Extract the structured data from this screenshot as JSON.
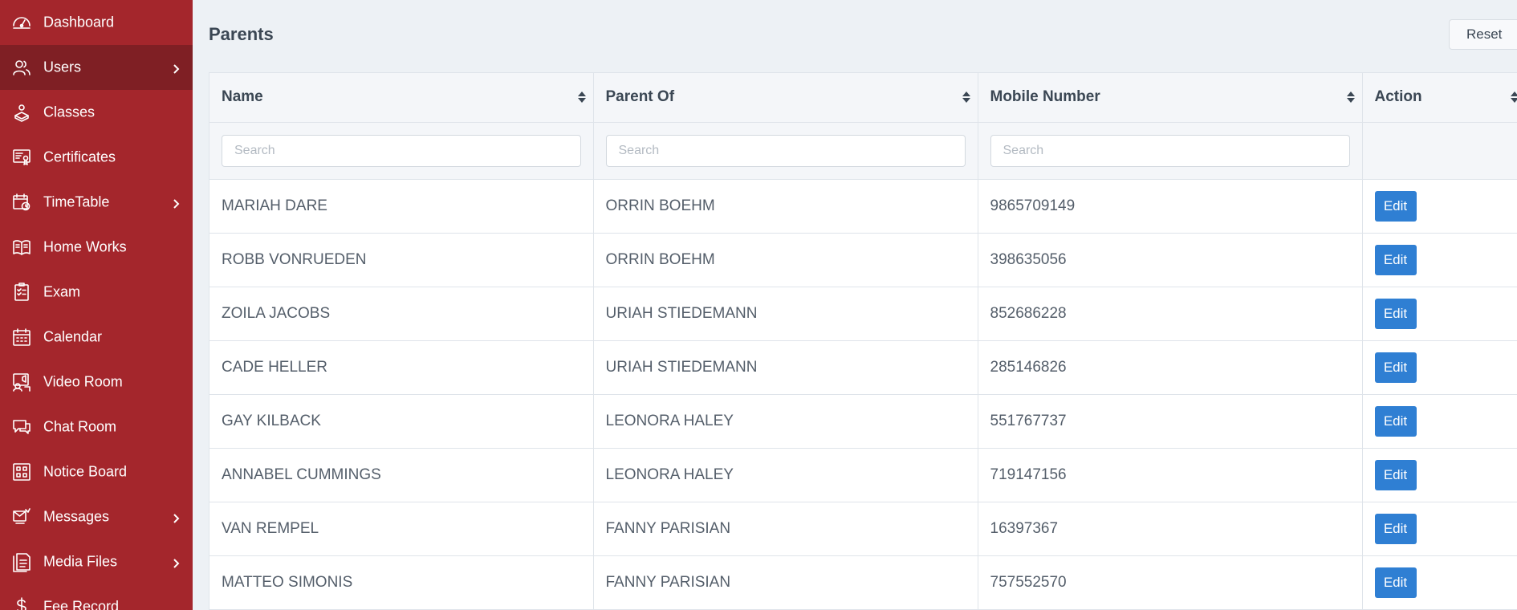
{
  "sidebar": {
    "items": [
      {
        "label": "Dashboard",
        "icon": "dashboard-icon",
        "has_submenu": false,
        "active": false
      },
      {
        "label": "Users",
        "icon": "users-icon",
        "has_submenu": true,
        "active": true
      },
      {
        "label": "Classes",
        "icon": "classes-icon",
        "has_submenu": false,
        "active": false
      },
      {
        "label": "Certificates",
        "icon": "certificate-icon",
        "has_submenu": false,
        "active": false
      },
      {
        "label": "TimeTable",
        "icon": "timetable-icon",
        "has_submenu": true,
        "active": false
      },
      {
        "label": "Home Works",
        "icon": "book-icon",
        "has_submenu": false,
        "active": false
      },
      {
        "label": "Exam",
        "icon": "exam-icon",
        "has_submenu": false,
        "active": false
      },
      {
        "label": "Calendar",
        "icon": "calendar-icon",
        "has_submenu": false,
        "active": false
      },
      {
        "label": "Video Room",
        "icon": "video-room-icon",
        "has_submenu": false,
        "active": false
      },
      {
        "label": "Chat Room",
        "icon": "chat-icon",
        "has_submenu": false,
        "active": false
      },
      {
        "label": "Notice Board",
        "icon": "notice-board-icon",
        "has_submenu": false,
        "active": false
      },
      {
        "label": "Messages",
        "icon": "messages-icon",
        "has_submenu": true,
        "active": false
      },
      {
        "label": "Media Files",
        "icon": "media-files-icon",
        "has_submenu": true,
        "active": false
      },
      {
        "label": "Fee Record",
        "icon": "dollar-icon",
        "has_submenu": false,
        "active": false
      }
    ]
  },
  "main": {
    "title": "Parents",
    "reset_label": "Reset"
  },
  "table": {
    "columns": [
      "Name",
      "Parent Of",
      "Mobile Number",
      "Action"
    ],
    "search_placeholder": "Search",
    "edit_label": "Edit",
    "rows": [
      {
        "name": "MARIAH DARE",
        "parent_of": "ORRIN BOEHM",
        "mobile": "9865709149"
      },
      {
        "name": "ROBB VONRUEDEN",
        "parent_of": "ORRIN BOEHM",
        "mobile": "398635056"
      },
      {
        "name": "ZOILA JACOBS",
        "parent_of": "URIAH STIEDEMANN",
        "mobile": "852686228"
      },
      {
        "name": "CADE HELLER",
        "parent_of": "URIAH STIEDEMANN",
        "mobile": "285146826"
      },
      {
        "name": "GAY KILBACK",
        "parent_of": "LEONORA HALEY",
        "mobile": "551767737"
      },
      {
        "name": "ANNABEL CUMMINGS",
        "parent_of": "LEONORA HALEY",
        "mobile": "719147156"
      },
      {
        "name": "VAN REMPEL",
        "parent_of": "FANNY PARISIAN",
        "mobile": "16397367"
      },
      {
        "name": "MATTEO SIMONIS",
        "parent_of": "FANNY PARISIAN",
        "mobile": "757552570"
      }
    ]
  },
  "colors": {
    "sidebar_bg": "#a4262c",
    "sidebar_active_bg": "#7f1f24",
    "edit_button": "#2f7fd3",
    "page_bg": "#edf1f5"
  }
}
